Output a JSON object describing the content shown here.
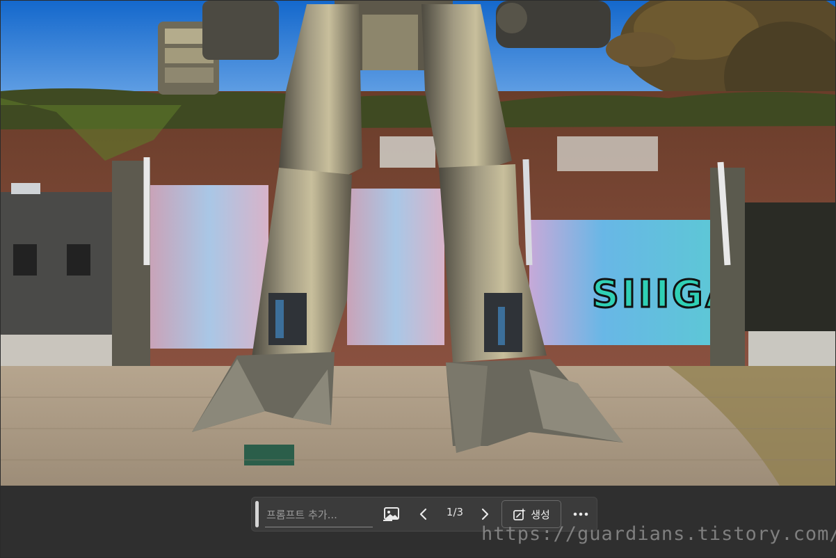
{
  "toolbar": {
    "prompt_placeholder": "프롬프트 추가...",
    "page_counter": "1/3",
    "generate_label": "생성",
    "icons": {
      "handle": "drag-handle-icon",
      "image": "image-reference-icon",
      "prev": "chevron-left-icon",
      "next": "chevron-right-icon",
      "generate": "sparkle-edit-icon",
      "more": "more-horizontal-icon"
    }
  },
  "photo": {
    "graffiti_text": "SIIIGA"
  },
  "watermark": {
    "text": "https://guardians.tistory.com/"
  },
  "colors": {
    "bar_bg": "#2f2f2f",
    "toolbar_bg": "#3b3b3b",
    "text": "#eaeaea"
  }
}
